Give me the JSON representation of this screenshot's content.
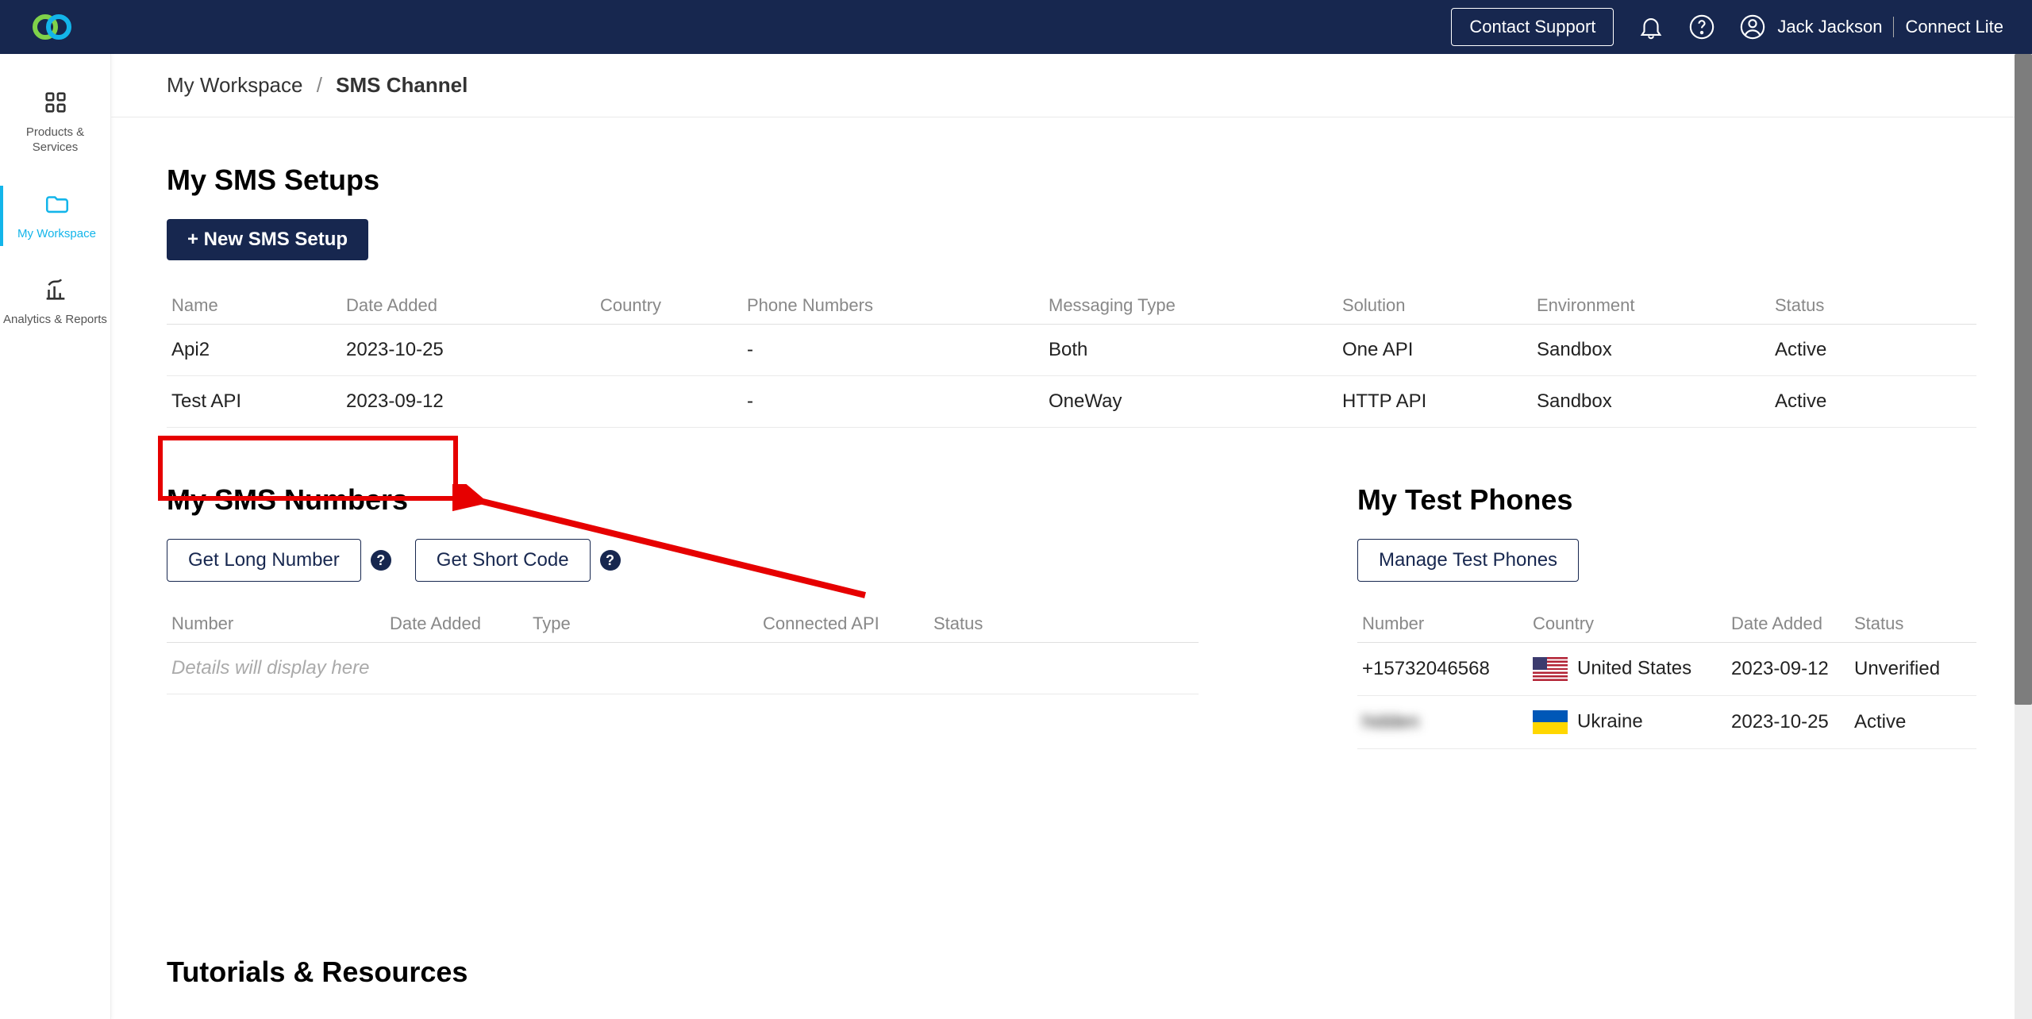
{
  "header": {
    "contact_support": "Contact Support",
    "user_name": "Jack Jackson",
    "plan": "Connect Lite"
  },
  "sidebar": {
    "items": [
      {
        "label": "Products & Services"
      },
      {
        "label": "My Workspace"
      },
      {
        "label": "Analytics & Reports"
      }
    ]
  },
  "breadcrumb": {
    "root": "My Workspace",
    "sep": "/",
    "current": "SMS Channel"
  },
  "sms_setups": {
    "title": "My SMS Setups",
    "new_button": "+ New SMS Setup",
    "columns": [
      "Name",
      "Date Added",
      "Country",
      "Phone Numbers",
      "Messaging Type",
      "Solution",
      "Environment",
      "Status"
    ],
    "rows": [
      {
        "name": "Api2",
        "date_added": "2023-10-25",
        "country": "",
        "phone": "-",
        "messaging_type": "Both",
        "solution": "One API",
        "environment": "Sandbox",
        "status": "Active"
      },
      {
        "name": "Test API",
        "date_added": "2023-09-12",
        "country": "",
        "phone": "-",
        "messaging_type": "OneWay",
        "solution": "HTTP API",
        "environment": "Sandbox",
        "status": "Active"
      }
    ]
  },
  "sms_numbers": {
    "title": "My SMS Numbers",
    "get_long": "Get Long Number",
    "get_short": "Get Short Code",
    "columns": [
      "Number",
      "Date Added",
      "Type",
      "Connected API",
      "Status"
    ],
    "empty": "Details will display here"
  },
  "test_phones": {
    "title": "My Test Phones",
    "manage": "Manage Test Phones",
    "columns": [
      "Number",
      "Country",
      "Date Added",
      "Status"
    ],
    "rows": [
      {
        "number": "+15732046568",
        "flag": "us",
        "country": "United States",
        "date_added": "2023-09-12",
        "status": "Unverified"
      },
      {
        "number": "hidden",
        "flag": "ua",
        "country": "Ukraine",
        "date_added": "2023-10-25",
        "status": "Active"
      }
    ]
  },
  "tutorials": {
    "title": "Tutorials & Resources"
  },
  "help_glyph": "?"
}
